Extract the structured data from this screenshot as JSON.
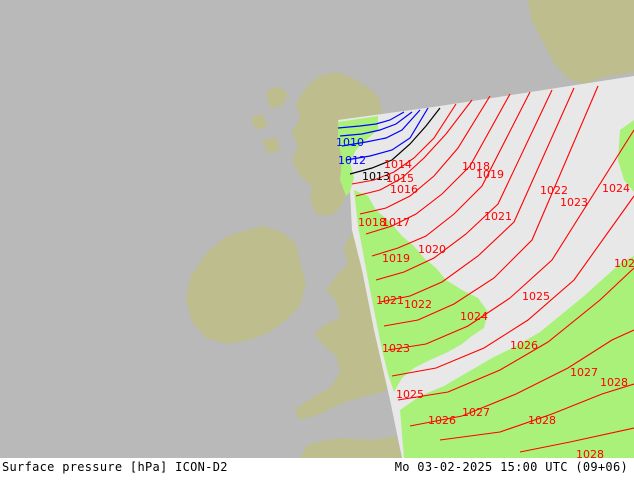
{
  "footer": {
    "left": "Surface pressure [hPa] ICON-D2",
    "right": "Mo 03-02-2025 15:00 UTC (09+06)"
  },
  "colors": {
    "sea_outside": "#b9b9b9",
    "land_outside": "#bdbd8e",
    "model_sea": "#e8e8e8",
    "model_land": "#aaf17a",
    "isobar_low": "#0000ff",
    "isobar_mid": "#000000",
    "isobar_high": "#ff0000"
  },
  "isobar_labels": [
    {
      "text": "1010",
      "color": "blue"
    },
    {
      "text": "1012",
      "color": "blue"
    },
    {
      "text": "1013",
      "color": "black"
    },
    {
      "text": "1014",
      "color": "red"
    },
    {
      "text": "1015",
      "color": "red"
    },
    {
      "text": "1016",
      "color": "red"
    },
    {
      "text": "1017",
      "color": "red"
    },
    {
      "text": "1018",
      "color": "red"
    },
    {
      "text": "1018",
      "color": "red"
    },
    {
      "text": "1019",
      "color": "red"
    },
    {
      "text": "1019",
      "color": "red"
    },
    {
      "text": "1020",
      "color": "red"
    },
    {
      "text": "1021",
      "color": "red"
    },
    {
      "text": "1021",
      "color": "red"
    },
    {
      "text": "1022",
      "color": "red"
    },
    {
      "text": "1022",
      "color": "red"
    },
    {
      "text": "1023",
      "color": "red"
    },
    {
      "text": "1023",
      "color": "red"
    },
    {
      "text": "1024",
      "color": "red"
    },
    {
      "text": "1024",
      "color": "red"
    },
    {
      "text": "1025",
      "color": "red"
    },
    {
      "text": "1025",
      "color": "red"
    },
    {
      "text": "1026",
      "color": "red"
    },
    {
      "text": "1026",
      "color": "red"
    },
    {
      "text": "1027",
      "color": "red"
    },
    {
      "text": "1027",
      "color": "red"
    },
    {
      "text": "1028",
      "color": "red"
    },
    {
      "text": "1028",
      "color": "red"
    },
    {
      "text": "1028",
      "color": "red"
    },
    {
      "text": "102",
      "color": "red"
    }
  ]
}
